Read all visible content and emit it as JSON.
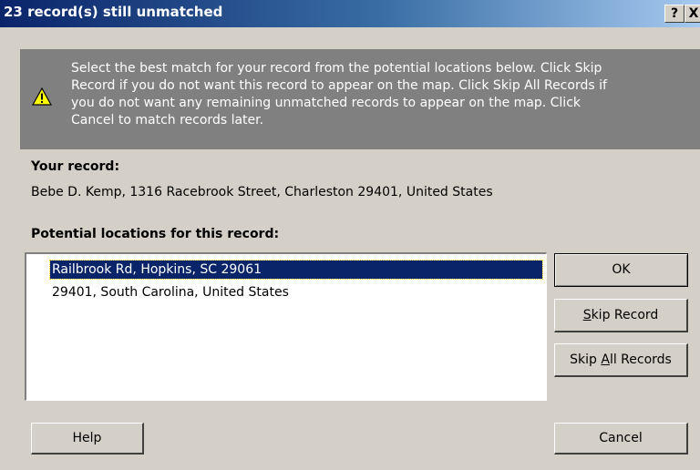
{
  "window": {
    "title": "23 record(s) still unmatched",
    "help_glyph": "?",
    "close_glyph": "X"
  },
  "banner": {
    "icon": "warning-icon",
    "lines": [
      "Select the best match for your record from the potential locations below. Click Skip",
      "Record if you do not want this record to appear on the map. Click Skip All Records if",
      "you do not want any remaining unmatched records to appear on the map. Click",
      "Cancel to match records later."
    ]
  },
  "record": {
    "label": "Your record:",
    "value": "Bebe D. Kemp, 1316 Racebrook Street, Charleston 29401, United States"
  },
  "locations": {
    "label": "Potential locations for this record:",
    "items": [
      "Railbrook Rd, Hopkins, SC 29061",
      "29401, South Carolina, United States"
    ],
    "selected_index": 0
  },
  "buttons": {
    "ok": "OK",
    "skip_record_mnemonic": "S",
    "skip_record_rest": "kip Record",
    "skip_all_prefix": "Skip ",
    "skip_all_mnemonic": "A",
    "skip_all_rest": "ll Records",
    "help": "Help",
    "cancel": "Cancel"
  },
  "colors": {
    "title_start": "#0a246a",
    "title_end": "#a6caf0",
    "dialog_face": "#d4d0c8",
    "banner": "#808080",
    "selection": "#0a246a",
    "warning_yellow": "#ffff00"
  }
}
